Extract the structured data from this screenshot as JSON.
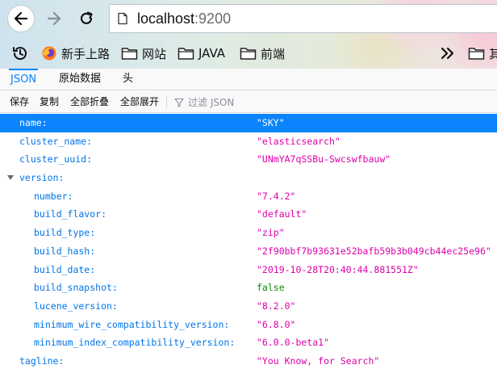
{
  "browser": {
    "url_host": "localhost",
    "url_port": ":9200",
    "bookmarks": [
      {
        "label": "新手上路",
        "icon": "firefox-icon"
      },
      {
        "label": "网站",
        "icon": "folder-icon"
      },
      {
        "label": "JAVA",
        "icon": "folder-icon"
      },
      {
        "label": "前端",
        "icon": "folder-icon"
      }
    ],
    "overflow_folder_label": "其"
  },
  "viewer": {
    "tabs": [
      "JSON",
      "原始数据",
      "头"
    ],
    "active_tab": "JSON",
    "toolbar": {
      "save": "保存",
      "copy": "复制",
      "collapse_all": "全部折叠",
      "expand_all": "全部展开",
      "filter_placeholder": "过滤 JSON"
    },
    "accent_color": "#0a84ff",
    "rows": [
      {
        "key": "name:",
        "value": "\"SKY\""
      },
      {
        "key": "cluster_name:",
        "value": "\"elasticsearch\""
      },
      {
        "key": "cluster_uuid:",
        "value": "\"UNmYA7qSSBu-Swcswfbauw\""
      },
      {
        "key": "version:",
        "value": ""
      },
      {
        "key": "number:",
        "value": "\"7.4.2\""
      },
      {
        "key": "build_flavor:",
        "value": "\"default\""
      },
      {
        "key": "build_type:",
        "value": "\"zip\""
      },
      {
        "key": "build_hash:",
        "value": "\"2f90bbf7b93631e52bafb59b3b049cb44ec25e96\""
      },
      {
        "key": "build_date:",
        "value": "\"2019-10-28T20:40:44.881551Z\""
      },
      {
        "key": "build_snapshot:",
        "value": "false"
      },
      {
        "key": "lucene_version:",
        "value": "\"8.2.0\""
      },
      {
        "key": "minimum_wire_compatibility_version:",
        "value": "\"6.8.0\""
      },
      {
        "key": "minimum_index_compatibility_version:",
        "value": "\"6.0.0-beta1\""
      },
      {
        "key": "tagline:",
        "value": "\"You Know, for Search\""
      }
    ]
  }
}
